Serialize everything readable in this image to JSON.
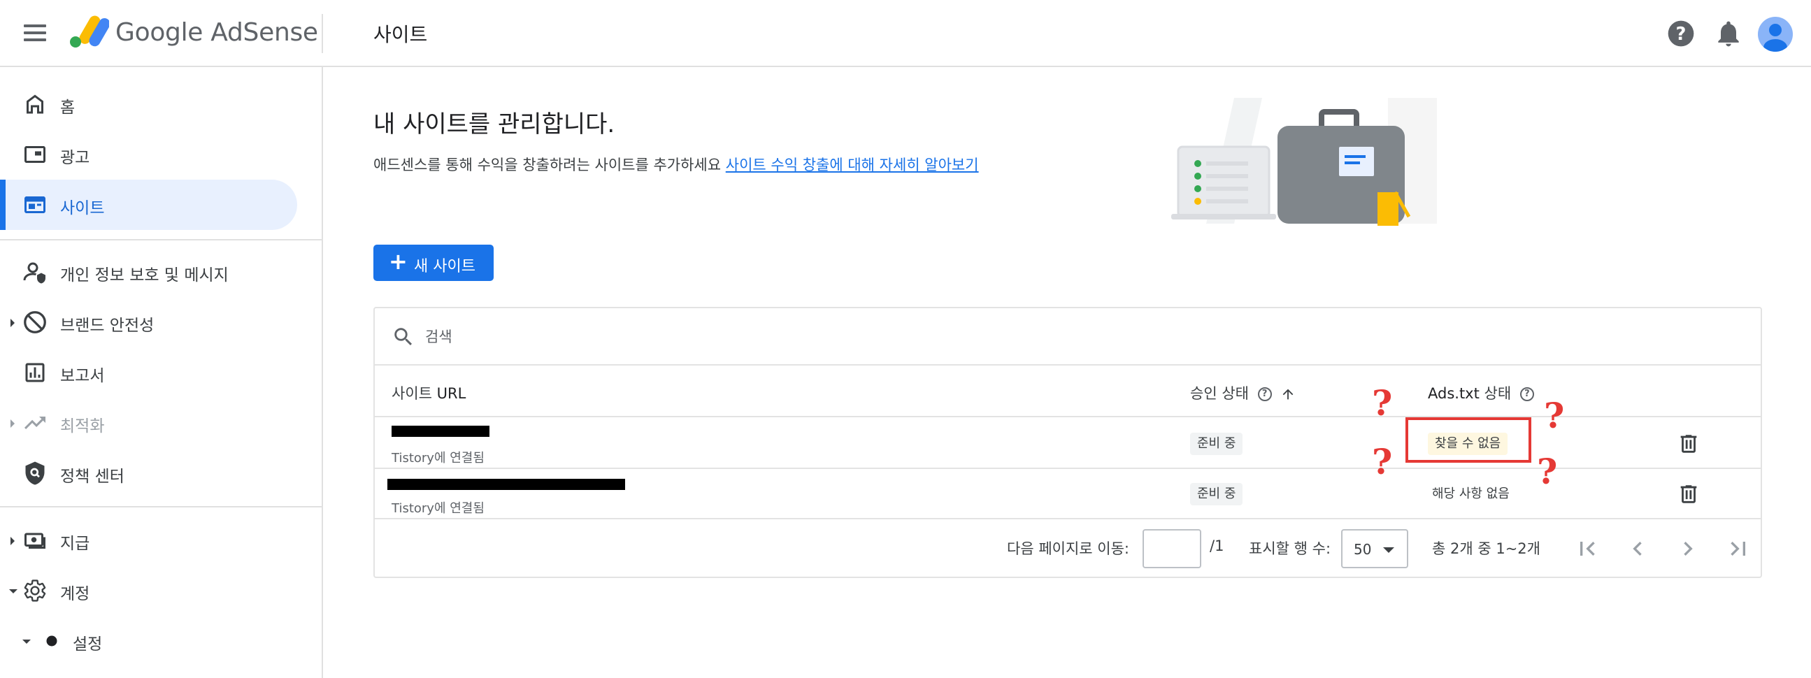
{
  "header": {
    "brand": "Google AdSense",
    "page_title": "사이트",
    "icons": [
      "menu-icon",
      "help-icon",
      "notifications-icon",
      "account-avatar"
    ]
  },
  "sidebar": {
    "items": [
      {
        "label": "홈",
        "icon": "home-icon"
      },
      {
        "label": "광고",
        "icon": "ads-icon"
      },
      {
        "label": "사이트",
        "icon": "sites-icon",
        "active": true
      },
      {
        "label": "개인 정보 보호 및 메시지",
        "icon": "privacy-messaging-icon"
      },
      {
        "label": "브랜드 안전성",
        "icon": "block-icon"
      },
      {
        "label": "보고서",
        "icon": "reports-icon"
      },
      {
        "label": "최적화",
        "icon": "trending-icon",
        "disabled": true
      },
      {
        "label": "정책 센터",
        "icon": "policy-shield-icon"
      },
      {
        "label": "지급",
        "icon": "payments-icon"
      },
      {
        "label": "계정",
        "icon": "gear-icon"
      },
      {
        "label": "설정",
        "icon": "dot-icon"
      }
    ]
  },
  "main": {
    "heading": "내 사이트를 관리합니다.",
    "description": "애드센스를 통해 수익을 창출하려는 사이트를 추가하세요",
    "learn_more_link": "사이트 수익 창출에 대해 자세히 알아보기",
    "new_site_button": "새 사이트",
    "search_placeholder": "검색",
    "columns": {
      "site_url_prefix": "사이트",
      "site_url": "URL",
      "approval_status": "승인 상태",
      "ads_txt_prefix": "Ads.txt",
      "ads_txt_suffix": "상태"
    },
    "rows": [
      {
        "sub": "Tistory에 연결됨",
        "approval": "준비 중",
        "ads_txt": "찾을 수 없음"
      },
      {
        "sub": "Tistory에 연결됨",
        "approval": "준비 중",
        "ads_txt": "해당 사항 없음"
      }
    ],
    "pagination": {
      "goto_label": "다음 페이지로 이동:",
      "page_total": "/1",
      "rows_label": "표시할 행 수:",
      "rows_value": "50",
      "range_text": "총 2개 중 1~2개"
    }
  },
  "annotations": {
    "mark": "?",
    "color": "#e53935"
  },
  "colors": {
    "accent": "#1a73e8",
    "active_bg": "#e8f0fe",
    "warn_chip": "#fef7e0"
  }
}
